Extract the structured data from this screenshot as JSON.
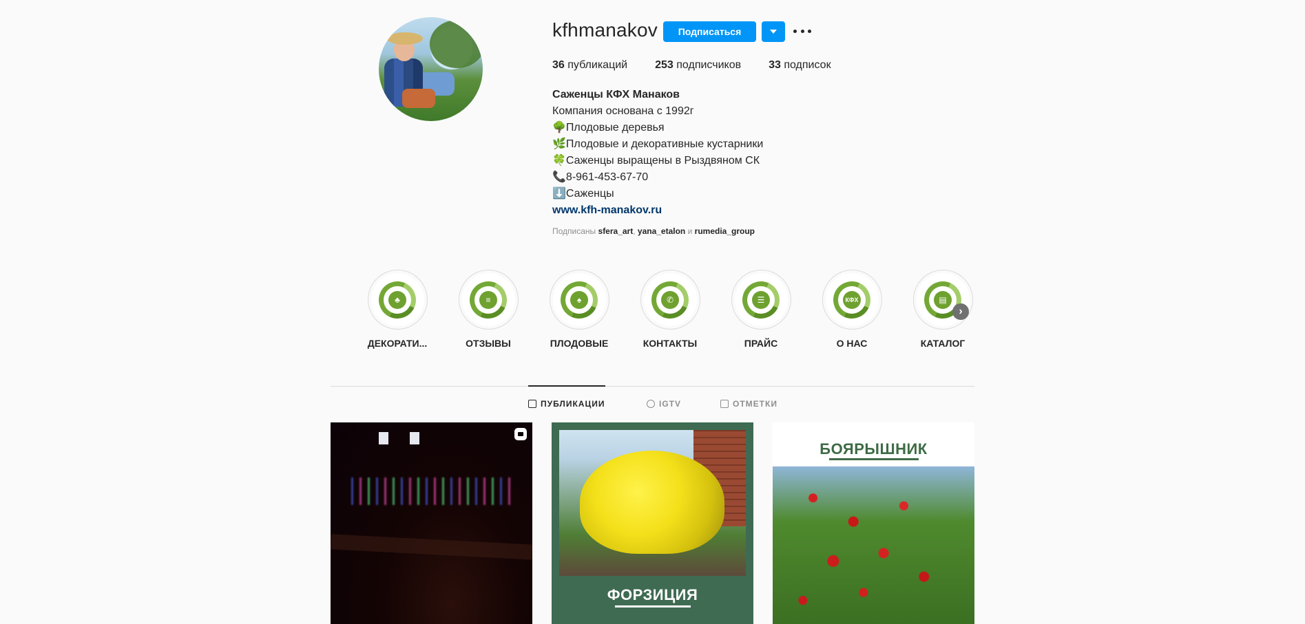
{
  "profile": {
    "username": "kfhmanakov",
    "follow_label": "Подписаться",
    "stats": {
      "posts": "36",
      "posts_label": "публикаций",
      "followers": "253",
      "followers_label": "подписчиков",
      "following": "33",
      "following_label": "подписок"
    },
    "bio": {
      "name": "Саженцы КФХ Манаков",
      "lines": [
        "Компания основана с 1992г",
        "🌳Плодовые деревья",
        "🌿Плодовые и декоративные кустарники",
        "🍀Саженцы выращены в Рыздвяном СК",
        "📞8-961-453-67-70",
        "⬇️Саженцы"
      ],
      "link": "www.kfh-manakov.ru"
    },
    "followed_by": {
      "prefix": "Подписаны",
      "user1": "sfera_art",
      "user2": "yana_etalon",
      "conj": "и",
      "user3": "rumedia_group"
    }
  },
  "highlights": [
    {
      "label": "ДЕКОРАТИ...",
      "icon": "tree-icon",
      "glyph": "♣"
    },
    {
      "label": "ОТЗЫВЫ",
      "icon": "chat-icon",
      "glyph": "≡"
    },
    {
      "label": "ПЛОДОВЫЕ",
      "icon": "fruit-tree-icon",
      "glyph": "♠"
    },
    {
      "label": "КОНТАКТЫ",
      "icon": "phone-icon",
      "glyph": "✆"
    },
    {
      "label": "ПРАЙС",
      "icon": "clipboard-icon",
      "glyph": "☰"
    },
    {
      "label": "О НАС",
      "icon": "kfh-logo-icon",
      "glyph": "КФХ"
    },
    {
      "label": "КАТАЛОГ",
      "icon": "book-icon",
      "glyph": "▤"
    }
  ],
  "tabs": {
    "posts": "ПУБЛИКАЦИИ",
    "igtv": "IGTV",
    "tagged": "ОТМЕТКИ"
  },
  "posts": [
    {
      "type": "reel"
    },
    {
      "caption": "ФОРЗИЦИЯ"
    },
    {
      "caption": "БОЯРЫШНИК"
    }
  ],
  "colors": {
    "accent": "#0095f6",
    "link": "#00376b",
    "highlight_green": "#74a836",
    "background": "#fafafa"
  }
}
